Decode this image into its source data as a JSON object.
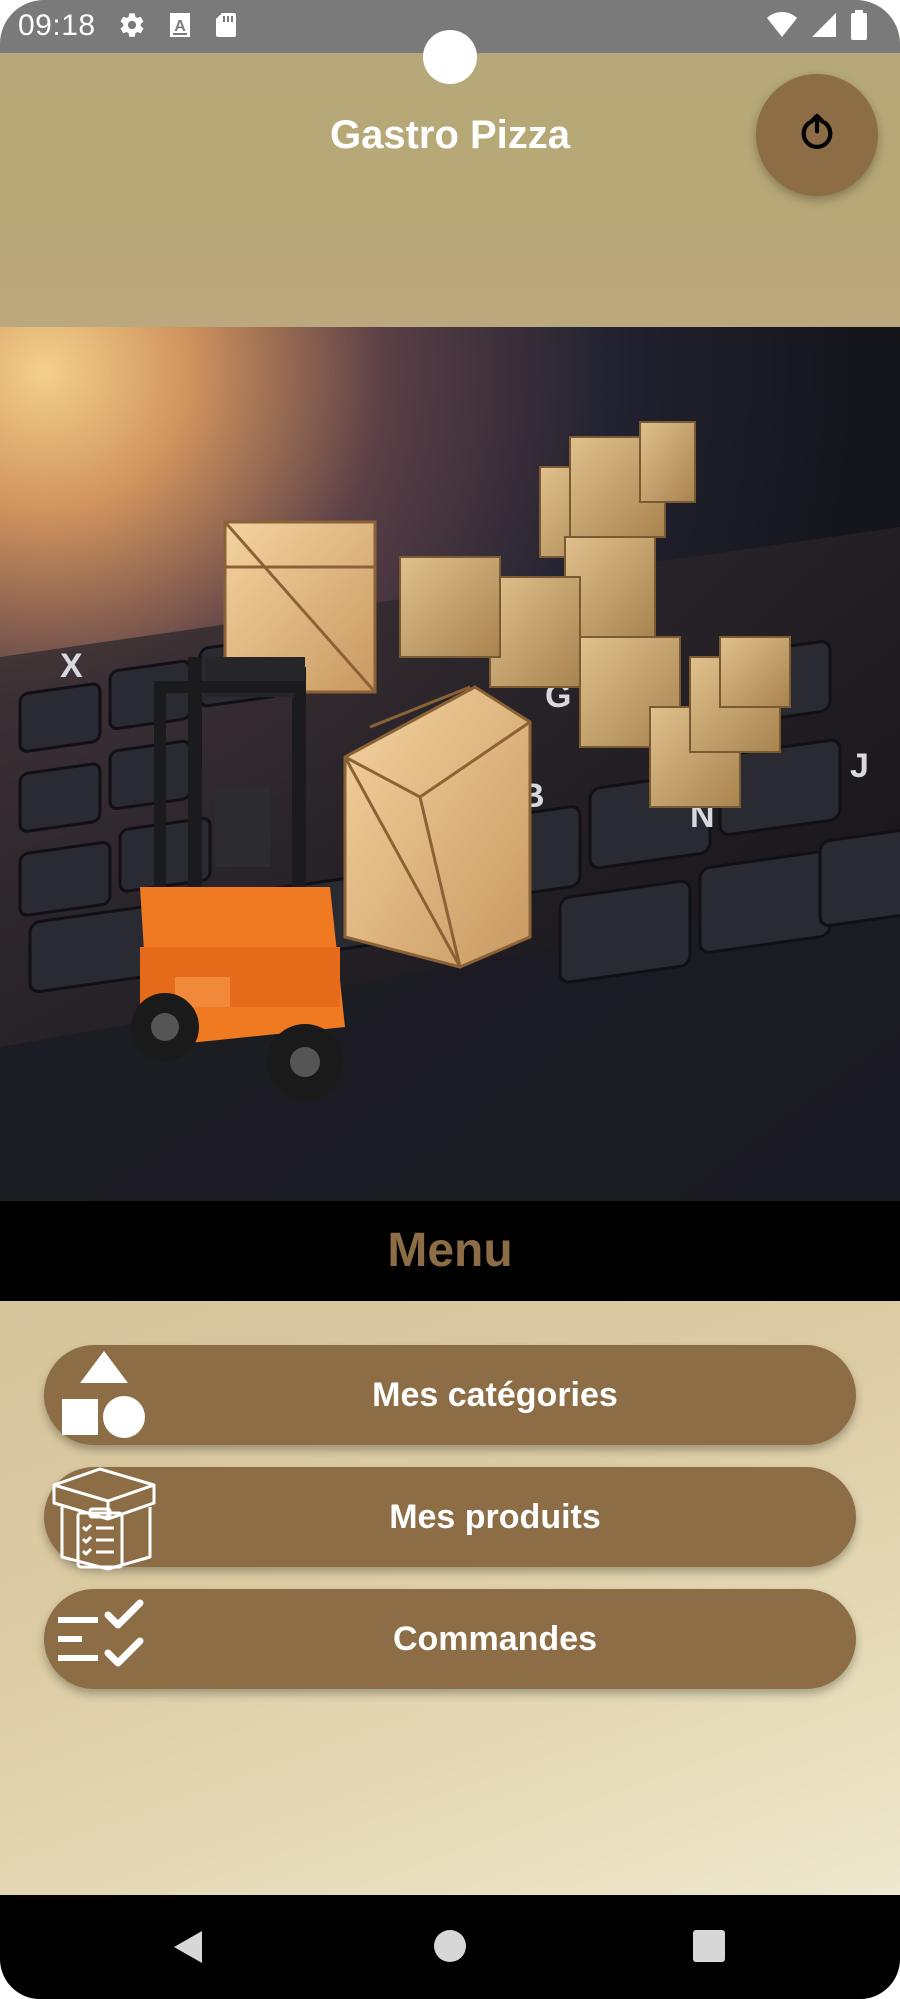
{
  "status_bar": {
    "time": "09:18",
    "left_icons": [
      "gear-icon",
      "font-a-icon",
      "sd-card-icon"
    ],
    "right_icons": [
      "wifi-icon",
      "signal-icon",
      "battery-icon"
    ]
  },
  "header": {
    "title": "Gastro Pizza",
    "power_icon": "power-icon"
  },
  "hero": {
    "description_icon": "forklift-boxes-keyboard-image"
  },
  "menu": {
    "title": "Menu",
    "items": [
      {
        "label": "Mes catégories",
        "icon": "shapes-icon"
      },
      {
        "label": "Mes produits",
        "icon": "box-checklist-icon"
      },
      {
        "label": "Commandes",
        "icon": "checklist-icon"
      }
    ]
  },
  "nav_bar": {
    "buttons": [
      "back-icon",
      "home-icon",
      "recents-icon"
    ]
  },
  "colors": {
    "accent": "#8c6d45",
    "header_bg": "#b8a878",
    "menu_banner_bg": "#000000",
    "status_bar_bg": "#7a7a7a"
  }
}
